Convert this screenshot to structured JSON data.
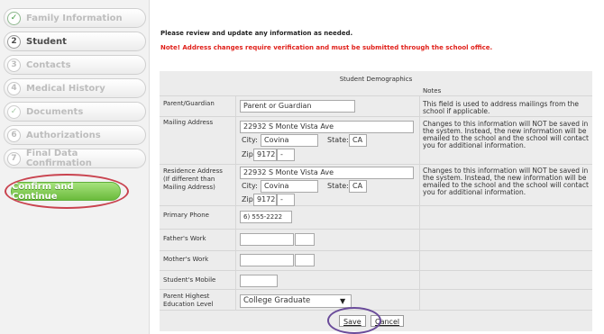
{
  "sidebar": {
    "steps": [
      {
        "label": "Family Information",
        "badge": "✓"
      },
      {
        "label": "Student",
        "badge": "2"
      },
      {
        "label": "Contacts",
        "badge": "3"
      },
      {
        "label": "Medical History",
        "badge": "4"
      },
      {
        "label": "Documents",
        "badge": "✓"
      },
      {
        "label": "Authorizations",
        "badge": "6"
      },
      {
        "label": "Final Data Confirmation",
        "badge": "7"
      }
    ],
    "confirm_button": "Confirm and Continue"
  },
  "main": {
    "review_message": "Please review and update any information as needed.",
    "address_warning": "Note! Address changes require verification and must be submitted through the school office.",
    "section_title": "Student Demographics",
    "notes_header": "Notes",
    "parent_guardian": {
      "label": "Parent/Guardian",
      "value": "Parent or Guardian",
      "note": "This field is used to address mailings from the school if applicable."
    },
    "mailing": {
      "label": "Mailing Address",
      "street": "22932 S Monte Vista Ave",
      "city_label": "City:",
      "city": "Covina",
      "state_label": "State:",
      "state": "CA",
      "zip_label": "Zip:",
      "zip": "9172:",
      "zip_ext": "-",
      "note": "Changes to this information will NOT be saved in the system. Instead, the new information will be emailed to the school and the school will contact you for additional information."
    },
    "residence": {
      "label_line1": "Residence Address",
      "label_line2": "(If different than",
      "label_line3": "Mailing Address)",
      "street": "22932 S Monte Vista Ave",
      "city_label": "City:",
      "city": "Covina",
      "state_label": "State:",
      "state": "CA",
      "zip_label": "Zip:",
      "zip": "9172:",
      "zip_ext": "-",
      "note": "Changes to this information will NOT be saved in the system. Instead, the new information will be emailed to the school and the school will contact you for additional information."
    },
    "primary_phone": {
      "label": "Primary Phone",
      "value": "6) 555-2222"
    },
    "fathers_work": {
      "label": "Father's Work",
      "value": "",
      "ext": ""
    },
    "mothers_work": {
      "label": "Mother's Work",
      "value": "",
      "ext": ""
    },
    "students_mobile": {
      "label": "Student's Mobile",
      "value": ""
    },
    "education": {
      "label_line1": "Parent Highest",
      "label_line2": "Education Level",
      "value": "College Graduate"
    },
    "save_label": "Save",
    "cancel_label": "Cancel"
  },
  "colors": {
    "warning": "#e0201a",
    "confirm_green": "#6bbb3c",
    "highlight_red": "#c9434f",
    "highlight_purple": "#6a4b9a"
  }
}
